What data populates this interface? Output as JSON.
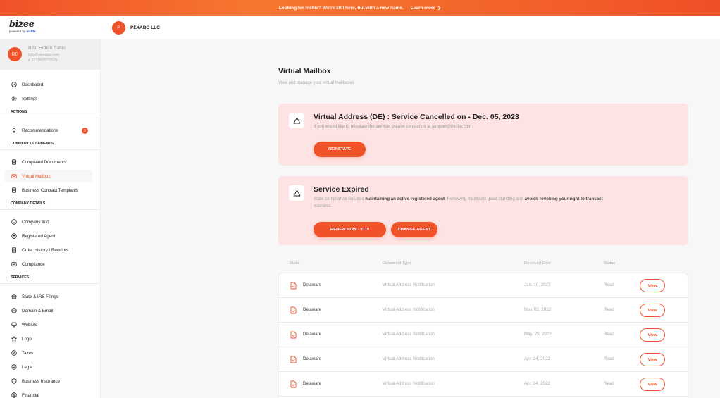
{
  "banner": {
    "message": "Looking for Incfile? We're still here, but with a new name.",
    "link": "Learn more"
  },
  "brand": {
    "logo": "bizee",
    "powered_by": "powered by",
    "powered_brand": "incfile"
  },
  "company": {
    "initial": "P",
    "name": "PEXABO LLC"
  },
  "user": {
    "initials": "RE",
    "name": "Rifat Erdem Sahin",
    "email": "info@pexabo.com",
    "id": "# 221092972525"
  },
  "sidebar": {
    "dashboard": "Dashboard",
    "settings": "Settings",
    "actions_header": "ACTIONS",
    "recommendations": "Recommendations",
    "recommendations_count": "2",
    "company_documents_header": "COMPANY DOCUMENTS",
    "completed_documents": "Completed Documents",
    "virtual_mailbox": "Virtual Mailbox",
    "business_contract_templates": "Business Contract Templates",
    "company_details_header": "COMPANY DETAILS",
    "company_info": "Company Info",
    "registered_agent": "Registered Agent",
    "order_history": "Order History / Receipts",
    "compliance": "Compliance",
    "services_header": "SERVICES",
    "state_irs_filings": "State & IRS Filings",
    "domain_email": "Domain & Email",
    "website": "Website",
    "logo": "Logo",
    "taxes": "Taxes",
    "legal": "Legal",
    "business_insurance": "Business Insurance",
    "financial": "Financial"
  },
  "page": {
    "title": "Virtual Mailbox",
    "subtitle": "View and manage your virtual mailboxes"
  },
  "alert_cancelled": {
    "title": "Virtual Address (DE) : Service Cancelled on - Dec. 05, 2023",
    "body": "If you would like to reinstate the service, please contact us at support@incfile.com.",
    "button": "REINSTATE"
  },
  "alert_expired": {
    "title": "Service Expired",
    "body_1": "State compliance requires ",
    "body_2": "maintaining an active registered agent",
    "body_3": ". Renewing maintains good standing and ",
    "body_4": "avoids revoking your right to transact",
    "body_5": "business",
    "body_6": ".",
    "renew_button": "RENEW NOW - $119",
    "change_button": "CHANGE AGENT"
  },
  "table": {
    "headers": {
      "state": "State",
      "document_type": "Document Type",
      "received_date": "Received Date",
      "status": "Status"
    },
    "view_label": "View",
    "rows": [
      {
        "state": "Delaware",
        "document_type": "Virtual Address Notification",
        "received_date": "Jan. 10, 2023",
        "status": "Read"
      },
      {
        "state": "Delaware",
        "document_type": "Virtual Address Notification",
        "received_date": "Nov. 02, 2022",
        "status": "Read"
      },
      {
        "state": "Delaware",
        "document_type": "Virtual Address Notification",
        "received_date": "May. 29, 2022",
        "status": "Read"
      },
      {
        "state": "Delaware",
        "document_type": "Virtual Address Notification",
        "received_date": "Apr. 24, 2022",
        "status": "Read"
      },
      {
        "state": "Delaware",
        "document_type": "Virtual Address Notification",
        "received_date": "Apr. 24, 2022",
        "status": "Read"
      }
    ]
  },
  "colors": {
    "accent": "#f0522a",
    "alert_bg": "#fde3e3",
    "link_blue": "#1c58c9"
  }
}
